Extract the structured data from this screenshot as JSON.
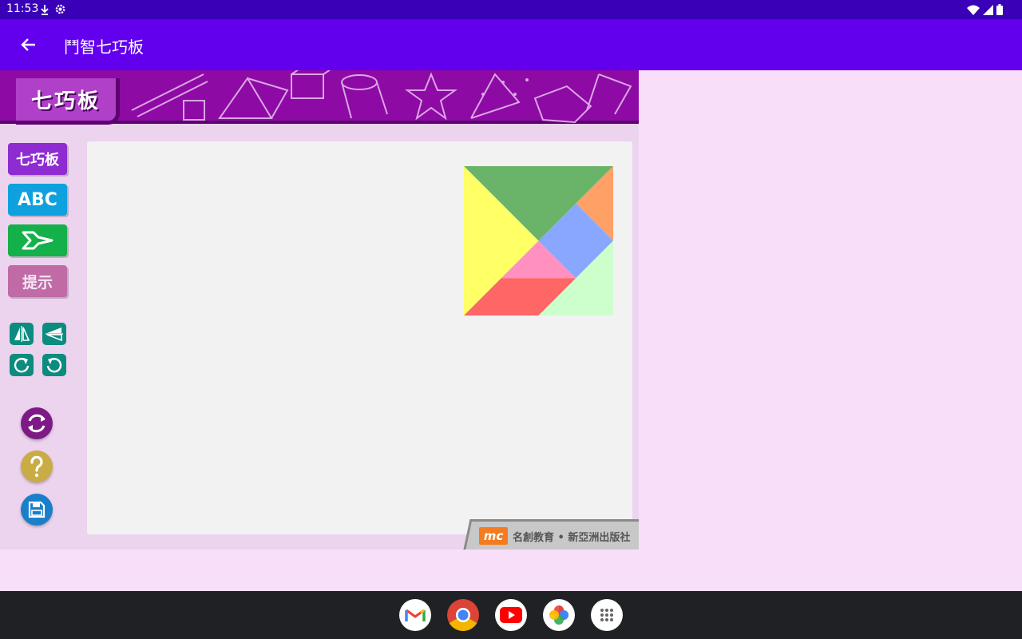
{
  "status_bar": {
    "time": "11:53"
  },
  "app_bar": {
    "title": "鬥智七巧板"
  },
  "game": {
    "banner_title": "七巧板",
    "side_buttons": {
      "tangram": "七巧板",
      "abc": "ABC",
      "hint": "提示"
    },
    "footer": {
      "logo": "mc",
      "text": "名創教育 • 新亞洲出版社"
    },
    "colors": {
      "green": "#6ab46a",
      "yellow": "#ffff66",
      "orange": "#ffa066",
      "blue": "#88a8ff",
      "pink": "#ff90c0",
      "red": "#ff6666",
      "mint": "#ccffcc"
    }
  },
  "icons": {
    "status_left": [
      "download-icon",
      "gear-icon"
    ],
    "status_right": [
      "wifi-icon",
      "signal-icon",
      "battery-icon"
    ],
    "tools": [
      "flip-horizontal-icon",
      "flip-vertical-icon",
      "rotate-clockwise-icon",
      "rotate-counterclockwise-icon"
    ],
    "actions": [
      "reset-icon",
      "help-icon",
      "save-icon"
    ],
    "dock": [
      "gmail-icon",
      "chrome-icon",
      "youtube-icon",
      "photos-icon",
      "app-drawer-icon"
    ]
  }
}
